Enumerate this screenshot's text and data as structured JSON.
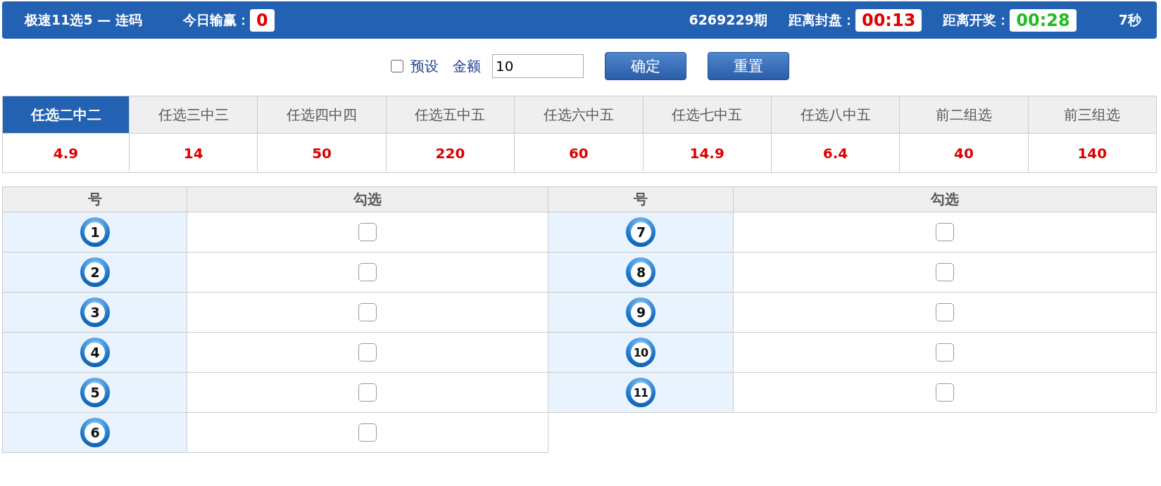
{
  "header": {
    "title": "极速11选5 — 连码",
    "profit_label": "今日输赢：",
    "profit": "0",
    "period": "6269229期",
    "close_label": "距离封盘：",
    "close_time": "00:13",
    "draw_label": "距离开奖：",
    "draw_time": "00:28",
    "refresh": "7秒"
  },
  "controls": {
    "preset": {
      "label": "预设",
      "checked": false
    },
    "amount_label": "金额",
    "amount": "10",
    "buttons": [
      "确定",
      "重置"
    ]
  },
  "play_types": [
    {
      "label": "任选二中二",
      "odds": "4.9",
      "selected": true
    },
    {
      "label": "任选三中三",
      "odds": "14",
      "selected": false
    },
    {
      "label": "任选四中四",
      "odds": "50",
      "selected": false
    },
    {
      "label": "任选五中五",
      "odds": "220",
      "selected": false
    },
    {
      "label": "任选六中五",
      "odds": "60",
      "selected": false
    },
    {
      "label": "任选七中五",
      "odds": "14.9",
      "selected": false
    },
    {
      "label": "任选八中五",
      "odds": "6.4",
      "selected": false
    },
    {
      "label": "前二组选",
      "odds": "40",
      "selected": false
    },
    {
      "label": "前三组选",
      "odds": "140",
      "selected": false
    }
  ],
  "number_table": {
    "columns": [
      "号",
      "勾选",
      "号",
      "勾选"
    ],
    "numbers": [
      {
        "number": "1",
        "checked": false
      },
      {
        "number": "2",
        "checked": false
      },
      {
        "number": "3",
        "checked": false
      },
      {
        "number": "4",
        "checked": false
      },
      {
        "number": "5",
        "checked": false
      },
      {
        "number": "6",
        "checked": false
      },
      {
        "number": "7",
        "checked": false
      },
      {
        "number": "8",
        "checked": false
      },
      {
        "number": "9",
        "checked": false
      },
      {
        "number": "10",
        "checked": false
      },
      {
        "number": "11",
        "checked": false
      }
    ]
  }
}
